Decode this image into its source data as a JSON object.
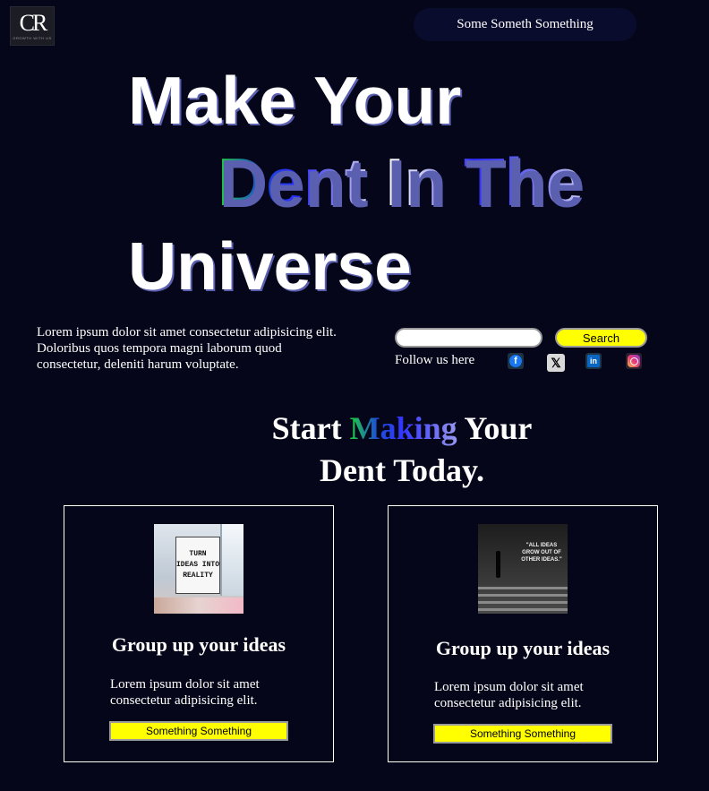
{
  "logo": {
    "mark": "CR",
    "sub": "GROWTH WITH US"
  },
  "nav": {
    "pill_label": "Some Someth Something"
  },
  "hero": {
    "line1": "Make Your",
    "line2": "Dent In The",
    "line3": "Universe"
  },
  "intro": {
    "text": "Lorem ipsum dolor sit amet consectetur adipisicing elit. Doloribus quos tempora magni laborum quod consectetur, deleniti harum voluptate."
  },
  "search": {
    "placeholder": "",
    "value": "",
    "button_label": "Search"
  },
  "social": {
    "follow_label": "Follow us here",
    "icons": [
      "facebook-icon",
      "x-icon",
      "linkedin-icon",
      "instagram-icon"
    ]
  },
  "cta": {
    "heading_pre": "Start ",
    "heading_highlight": "Making",
    "heading_post": " Your Dent Today."
  },
  "cards": [
    {
      "image_text": [
        "TURN",
        "IDEAS INTO",
        "REALITY"
      ],
      "title": "Group up your ideas",
      "body": "Lorem ipsum dolor sit amet consectetur adipisicing elit.",
      "button_label": "Something Something"
    },
    {
      "image_text": "\"ALL IDEAS GROW OUT OF OTHER IDEAS.\"",
      "title": "Group up your ideas",
      "body": "Lorem ipsum dolor sit amet consectetur adipisicing elit.",
      "button_label": "Something Something"
    }
  ],
  "colors": {
    "background": "#05061a",
    "accent_button": "#ffff00",
    "nav_pill": "#0a0c2e"
  }
}
